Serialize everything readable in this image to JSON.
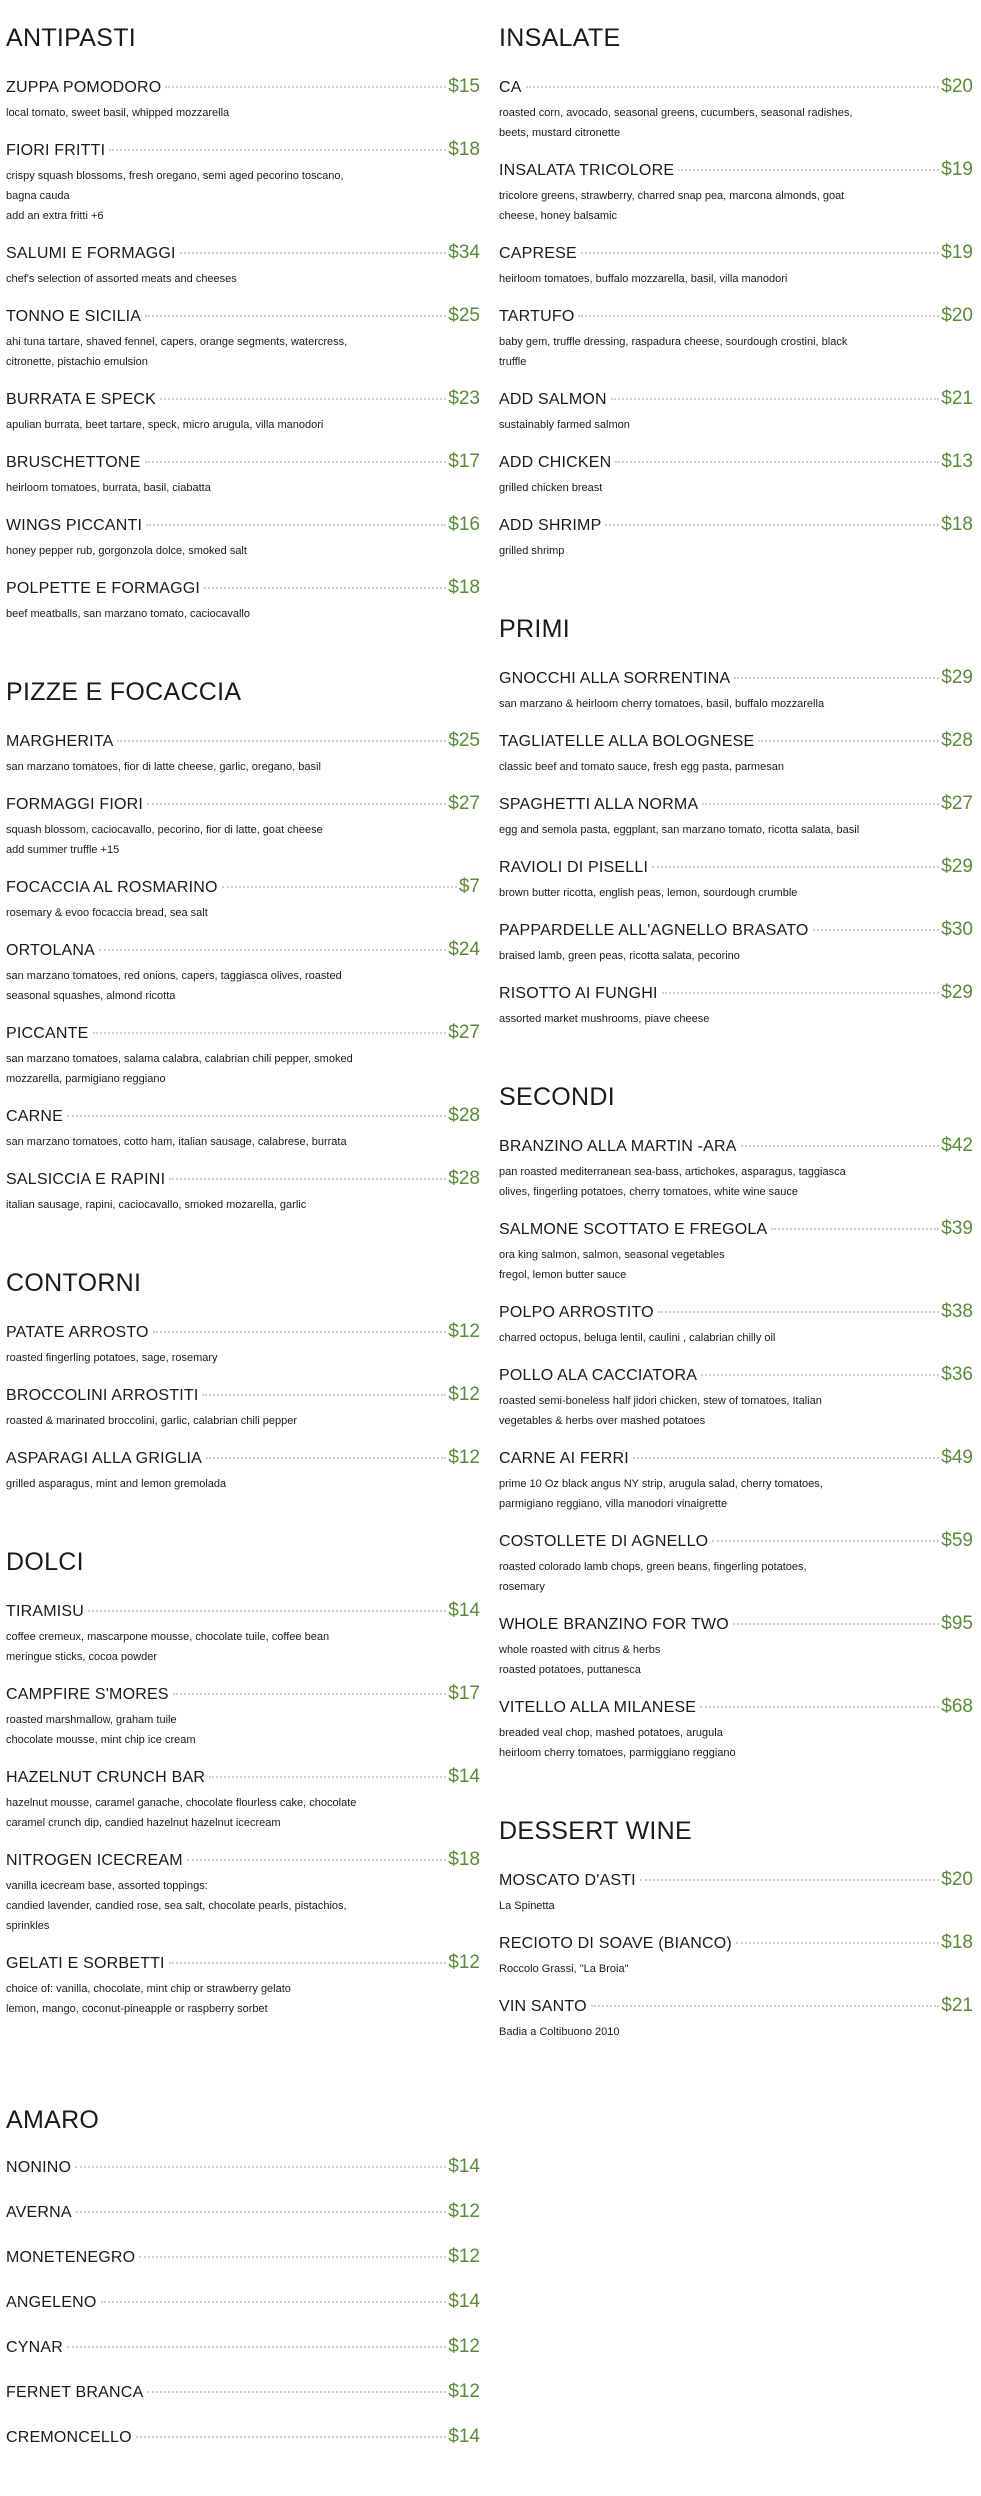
{
  "left_sections": [
    {
      "title": "ANTIPASTI",
      "items": [
        {
          "name": "ZUPPA POMODORO",
          "price": "$15",
          "desc": "local tomato, sweet basil, whipped mozzarella"
        },
        {
          "name": "FIORI FRITTI",
          "price": "$18",
          "desc": "crispy squash blossoms, fresh oregano, semi aged pecorino toscano,\nbagna cauda\nadd an extra fritti +6"
        },
        {
          "name": "SALUMI E FORMAGGI",
          "price": "$34",
          "desc": "chef's selection of assorted meats and cheeses"
        },
        {
          "name": "TONNO E SICILIA",
          "price": "$25",
          "desc": "ahi tuna tartare, shaved fennel, capers, orange segments, watercress,\ncitronette, pistachio emulsion"
        },
        {
          "name": "BURRATA E SPECK",
          "price": "$23",
          "desc": "apulian burrata, beet tartare, speck, micro arugula, villa manodori"
        },
        {
          "name": "BRUSCHETTONE",
          "price": "$17",
          "desc": "heirloom tomatoes, burrata, basil, ciabatta"
        },
        {
          "name": "WINGS PICCANTI",
          "price": "$16",
          "desc": "honey pepper rub, gorgonzola dolce, smoked salt"
        },
        {
          "name": "POLPETTE E FORMAGGI",
          "price": "$18",
          "desc": "beef meatballs, san marzano tomato, caciocavallo"
        }
      ]
    },
    {
      "title": "PIZZE E FOCACCIA",
      "items": [
        {
          "name": "MARGHERITA",
          "price": "$25",
          "desc": "san marzano tomatoes, fior di latte cheese, garlic, oregano, basil"
        },
        {
          "name": "FORMAGGI FIORI",
          "price": "$27",
          "desc": "squash blossom, caciocavallo, pecorino, fior di latte, goat cheese\nadd summer truffle +15"
        },
        {
          "name": "FOCACCIA AL ROSMARINO",
          "price": "$7",
          "desc": "rosemary & evoo focaccia bread, sea salt"
        },
        {
          "name": "ORTOLANA",
          "price": "$24",
          "desc": "san marzano tomatoes, red onions, capers, taggiasca olives, roasted\nseasonal squashes, almond ricotta"
        },
        {
          "name": "PICCANTE",
          "price": "$27",
          "desc": "san marzano tomatoes, salama calabra, calabrian chili pepper, smoked\nmozzarella, parmigiano reggiano"
        },
        {
          "name": "CARNE",
          "price": "$28",
          "desc": "san marzano tomatoes, cotto ham, italian sausage, calabrese, burrata"
        },
        {
          "name": "SALSICCIA E RAPINI",
          "price": "$28",
          "desc": "italian sausage, rapini, caciocavallo, smoked mozarella, garlic"
        }
      ]
    },
    {
      "title": "CONTORNI",
      "items": [
        {
          "name": "PATATE ARROSTO",
          "price": "$12",
          "desc": "roasted fingerling potatoes, sage, rosemary"
        },
        {
          "name": "BROCCOLINI ARROSTITI",
          "price": "$12",
          "desc": "roasted & marinated broccolini, garlic, calabrian chili pepper"
        },
        {
          "name": "ASPARAGI ALLA GRIGLIA",
          "price": "$12",
          "desc": "grilled asparagus, mint and lemon gremolada"
        }
      ]
    },
    {
      "title": "DOLCI",
      "items": [
        {
          "name": "TIRAMISU",
          "price": "$14",
          "desc": "coffee cremeux, mascarpone mousse, chocolate tuile, coffee bean\nmeringue sticks, cocoa powder"
        },
        {
          "name": "CAMPFIRE S'MORES",
          "price": "$17",
          "desc": "roasted marshmallow, graham tuile\nchocolate mousse, mint chip ice cream"
        },
        {
          "name": "HAZELNUT CRUNCH BAR",
          "price": "$14",
          "desc": "hazelnut mousse, caramel ganache, chocolate flourless cake, chocolate\ncaramel crunch dip, candied hazelnut hazelnut icecream"
        },
        {
          "name": "NITROGEN ICECREAM",
          "price": "$18",
          "desc": "vanilla icecream base, assorted toppings:\ncandied lavender, candied rose, sea salt, chocolate pearls, pistachios,\nsprinkles"
        },
        {
          "name": "GELATI E SORBETTI",
          "price": "$12",
          "desc": "choice of: vanilla, chocolate, mint chip or strawberry gelato\nlemon, mango, coconut-pineapple or raspberry sorbet"
        }
      ]
    }
  ],
  "right_sections": [
    {
      "title": "INSALATE",
      "items": [
        {
          "name": "CA",
          "price": "$20",
          "desc": "roasted corn, avocado, seasonal greens, cucumbers, seasonal radishes,\nbeets, mustard citronette"
        },
        {
          "name": "INSALATA TRICOLORE",
          "price": "$19",
          "desc": "tricolore greens, strawberry, charred snap pea, marcona almonds, goat\ncheese, honey balsamic"
        },
        {
          "name": "CAPRESE",
          "price": "$19",
          "desc": "heirloom tomatoes, buffalo mozzarella, basil, villa manodori"
        },
        {
          "name": "TARTUFO",
          "price": "$20",
          "desc": "baby gem, truffle dressing, raspadura cheese, sourdough crostini, black\ntruffle"
        },
        {
          "name": "ADD SALMON",
          "price": "$21",
          "desc": "sustainably farmed salmon"
        },
        {
          "name": "ADD CHICKEN",
          "price": "$13",
          "desc": "grilled chicken breast"
        },
        {
          "name": "ADD SHRIMP",
          "price": "$18",
          "desc": "grilled shrimp"
        }
      ]
    },
    {
      "title": "PRIMI",
      "items": [
        {
          "name": "GNOCCHI ALLA SORRENTINA",
          "price": "$29",
          "desc": "san marzano & heirloom cherry tomatoes, basil, buffalo mozzarella"
        },
        {
          "name": "TAGLIATELLE ALLA BOLOGNESE",
          "price": "$28",
          "desc": "classic beef and tomato sauce, fresh egg pasta, parmesan"
        },
        {
          "name": "SPAGHETTI ALLA NORMA",
          "price": "$27",
          "desc": "egg and semola pasta, eggplant, san marzano tomato, ricotta salata, basil"
        },
        {
          "name": "RAVIOLI DI PISELLI",
          "price": "$29",
          "desc": "brown butter ricotta, english peas, lemon, sourdough crumble"
        },
        {
          "name": "PAPPARDELLE ALL'AGNELLO BRASATO",
          "price": "$30",
          "desc": "braised lamb, green peas, ricotta salata, pecorino"
        },
        {
          "name": "RISOTTO AI FUNGHI",
          "price": "$29",
          "desc": "assorted market mushrooms, piave cheese"
        }
      ]
    },
    {
      "title": "SECONDI",
      "items": [
        {
          "name": "BRANZINO ALLA MARTIN -ARA",
          "price": "$42",
          "desc": "pan roasted mediterranean sea-bass, artichokes, asparagus, taggiasca\nolives, fingerling potatoes, cherry tomatoes, white wine sauce"
        },
        {
          "name": "SALMONE SCOTTATO E FREGOLA",
          "price": "$39",
          "desc": "ora king salmon, salmon, seasonal vegetables\nfregol, lemon butter sauce"
        },
        {
          "name": "POLPO ARROSTITO",
          "price": "$38",
          "desc": "charred octopus, beluga lentil, caulini , calabrian chilly oil"
        },
        {
          "name": "POLLO ALA CACCIATORA",
          "price": "$36",
          "desc": "roasted semi-boneless half jidori chicken, stew of tomatoes, Italian\nvegetables & herbs over mashed potatoes"
        },
        {
          "name": "CARNE AI FERRI",
          "price": "$49",
          "desc": "prime 10 Oz black angus NY strip, arugula salad, cherry tomatoes,\nparmigiano reggiano, villa manodori vinaigrette"
        },
        {
          "name": "COSTOLLETE DI AGNELLO",
          "price": "$59",
          "desc": "roasted colorado lamb chops, green beans, fingerling potatoes,\nrosemary"
        },
        {
          "name": "WHOLE BRANZINO FOR TWO",
          "price": "$95",
          "desc": "whole roasted with citrus & herbs\nroasted potatoes, puttanesca"
        },
        {
          "name": "VITELLO ALLA MILANESE",
          "price": "$68",
          "desc": "breaded veal chop, mashed potatoes, arugula\nheirloom cherry tomatoes, parmiggiano reggiano"
        }
      ]
    },
    {
      "title": "DESSERT WINE",
      "items": [
        {
          "name": "MOSCATO D'ASTI",
          "price": "$20",
          "desc": "La Spinetta"
        },
        {
          "name": "RECIOTO DI SOAVE (BIANCO)",
          "price": "$18",
          "desc": "Roccolo Grassi, \"La Broia\""
        },
        {
          "name": "VIN SANTO",
          "price": "$21",
          "desc": "Badia a Coltibuono 2010"
        }
      ]
    }
  ],
  "amaro": {
    "title": "AMARO",
    "items": [
      {
        "name": "NONINO",
        "price": "$14"
      },
      {
        "name": "AVERNA",
        "price": "$12"
      },
      {
        "name": "MONETENEGRO",
        "price": "$12"
      },
      {
        "name": "ANGELENO",
        "price": "$14"
      },
      {
        "name": "CYNAR",
        "price": "$12"
      },
      {
        "name": "FERNET BRANCA",
        "price": "$12"
      },
      {
        "name": "CREMONCELLO",
        "price": "$14"
      }
    ]
  },
  "colors": {
    "price": "#5a8a3a",
    "text": "#1a1a1a",
    "dots": "#cfcfcf"
  }
}
